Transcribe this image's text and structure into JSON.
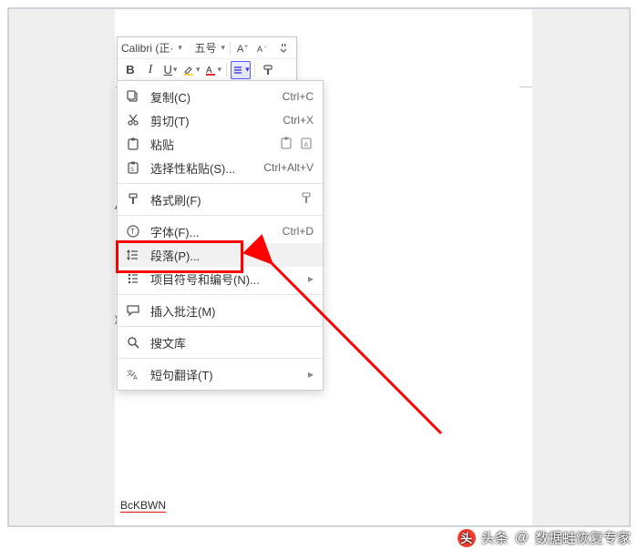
{
  "toolbar": {
    "font_name": "Calibri (正·",
    "font_size": "五号",
    "inc_font_icon": "A+",
    "dec_font_icon": "A-"
  },
  "context_menu": {
    "items": [
      {
        "icon": "copy",
        "label": "复制(C)",
        "shortcut": "Ctrl+C"
      },
      {
        "icon": "cut",
        "label": "剪切(T)",
        "shortcut": "Ctrl+X"
      },
      {
        "icon": "paste",
        "label": "粘贴",
        "shortcut": "",
        "trail": [
          "pasteA",
          "pasteB"
        ]
      },
      {
        "icon": "paste-sp",
        "label": "选择性粘贴(S)...",
        "shortcut": "Ctrl+Alt+V"
      },
      {
        "sep": true
      },
      {
        "icon": "brush",
        "label": "格式刷(F)",
        "trail": [
          "brush2"
        ]
      },
      {
        "sep": true
      },
      {
        "icon": "font",
        "label": "字体(F)...",
        "shortcut": "Ctrl+D"
      },
      {
        "icon": "para",
        "label": "段落(P)...",
        "highlight": true
      },
      {
        "icon": "bullets",
        "label": "项目符号和编号(N)...",
        "submenu": true
      },
      {
        "sep": true
      },
      {
        "icon": "comment",
        "label": "插入批注(M)"
      },
      {
        "sep": true
      },
      {
        "icon": "search",
        "label": "搜文库"
      },
      {
        "sep": true
      },
      {
        "icon": "translate",
        "label": "短句翻译(T)",
        "submenu": true
      }
    ]
  },
  "doc": {
    "bottom_text": "BcKBWN"
  },
  "watermark": {
    "source": "头条",
    "at": "@",
    "author": "数据蛙恢复专家"
  },
  "highlight_target": "段落(P)..."
}
